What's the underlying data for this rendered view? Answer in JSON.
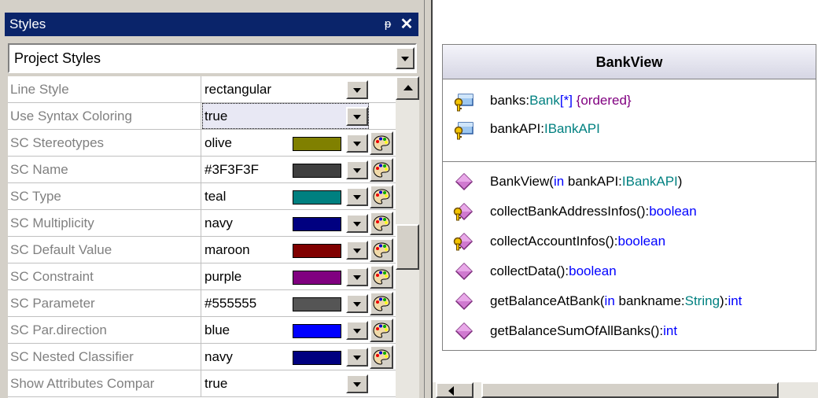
{
  "panel": {
    "title": "Styles",
    "pin_glyph": "ᵽ",
    "close_glyph": "✕",
    "scope_select": {
      "value": "Project Styles"
    }
  },
  "properties": [
    {
      "name": "Line Style",
      "value": "rectangular",
      "selected": false
    },
    {
      "name": "Use Syntax Coloring",
      "value": "true",
      "selected": true
    },
    {
      "name": "SC Stereotypes",
      "value": "olive",
      "color": "#808000"
    },
    {
      "name": "SC Name",
      "value": "#3F3F3F",
      "color": "#3F3F3F"
    },
    {
      "name": "SC Type",
      "value": "teal",
      "color": "#008080"
    },
    {
      "name": "SC Multiplicity",
      "value": "navy",
      "color": "#000080"
    },
    {
      "name": "SC Default Value",
      "value": "maroon",
      "color": "#800000"
    },
    {
      "name": "SC Constraint",
      "value": "purple",
      "color": "#800080"
    },
    {
      "name": "SC Parameter",
      "value": "#555555",
      "color": "#555555"
    },
    {
      "name": "SC Par.direction",
      "value": "blue",
      "color": "#0000FF"
    },
    {
      "name": "SC Nested Classifier",
      "value": "navy",
      "color": "#000080"
    },
    {
      "name": "Show Attributes Compar",
      "value": "true",
      "selected": false
    }
  ],
  "diagram": {
    "class_name": "BankView",
    "attributes": [
      {
        "icon": "protected-attribute-icon",
        "name": "banks",
        "sep": ":",
        "type": "Bank",
        "mult": "[*]",
        "constraint": "{ordered}"
      },
      {
        "icon": "protected-attribute-icon",
        "name": "bankAPI",
        "sep": ":",
        "type": "IBankAPI"
      }
    ],
    "operations": [
      {
        "icon": "public-operation-icon",
        "pre": "BankView(",
        "dir": "in",
        "param": " bankAPI:",
        "ptype": "IBankAPI",
        "post": ")",
        "ret": ""
      },
      {
        "icon": "protected-operation-icon",
        "pre": "collectBankAddressInfos():",
        "ret": "boolean"
      },
      {
        "icon": "protected-operation-icon",
        "pre": "collectAccountInfos():",
        "ret": "boolean"
      },
      {
        "icon": "public-operation-icon",
        "pre": "collectData():",
        "ret": "boolean"
      },
      {
        "icon": "public-operation-icon",
        "pre": "getBalanceAtBank(",
        "dir": "in",
        "param": " bankname:",
        "ptype": "String",
        "post": "):",
        "ret": "int"
      },
      {
        "icon": "public-operation-icon",
        "pre": "getBalanceSumOfAllBanks():",
        "ret": "int"
      }
    ]
  }
}
